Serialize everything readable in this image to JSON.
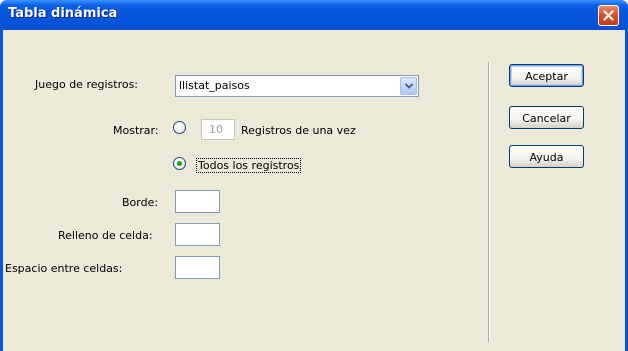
{
  "window": {
    "title": "Tabla dinámica"
  },
  "form": {
    "recordset_label": "Juego de registros:",
    "recordset_value": "llistat_paisos",
    "show_label": "Mostrar:",
    "records_count": "10",
    "records_at_once_label": "Registros de una vez",
    "all_records_label": "Todos los registros",
    "all_records_selected": true,
    "border_label": "Borde:",
    "border_value": "",
    "cell_padding_label": "Relleno de celda:",
    "cell_padding_value": "",
    "cell_spacing_label": "Espacio entre celdas:",
    "cell_spacing_value": ""
  },
  "buttons": {
    "ok": "Aceptar",
    "cancel": "Cancelar",
    "help": "Ayuda"
  },
  "colors": {
    "titlebar": "#0654d8",
    "client": "#ece9d8",
    "close": "#d9502c",
    "radio_dot": "#21a121"
  }
}
